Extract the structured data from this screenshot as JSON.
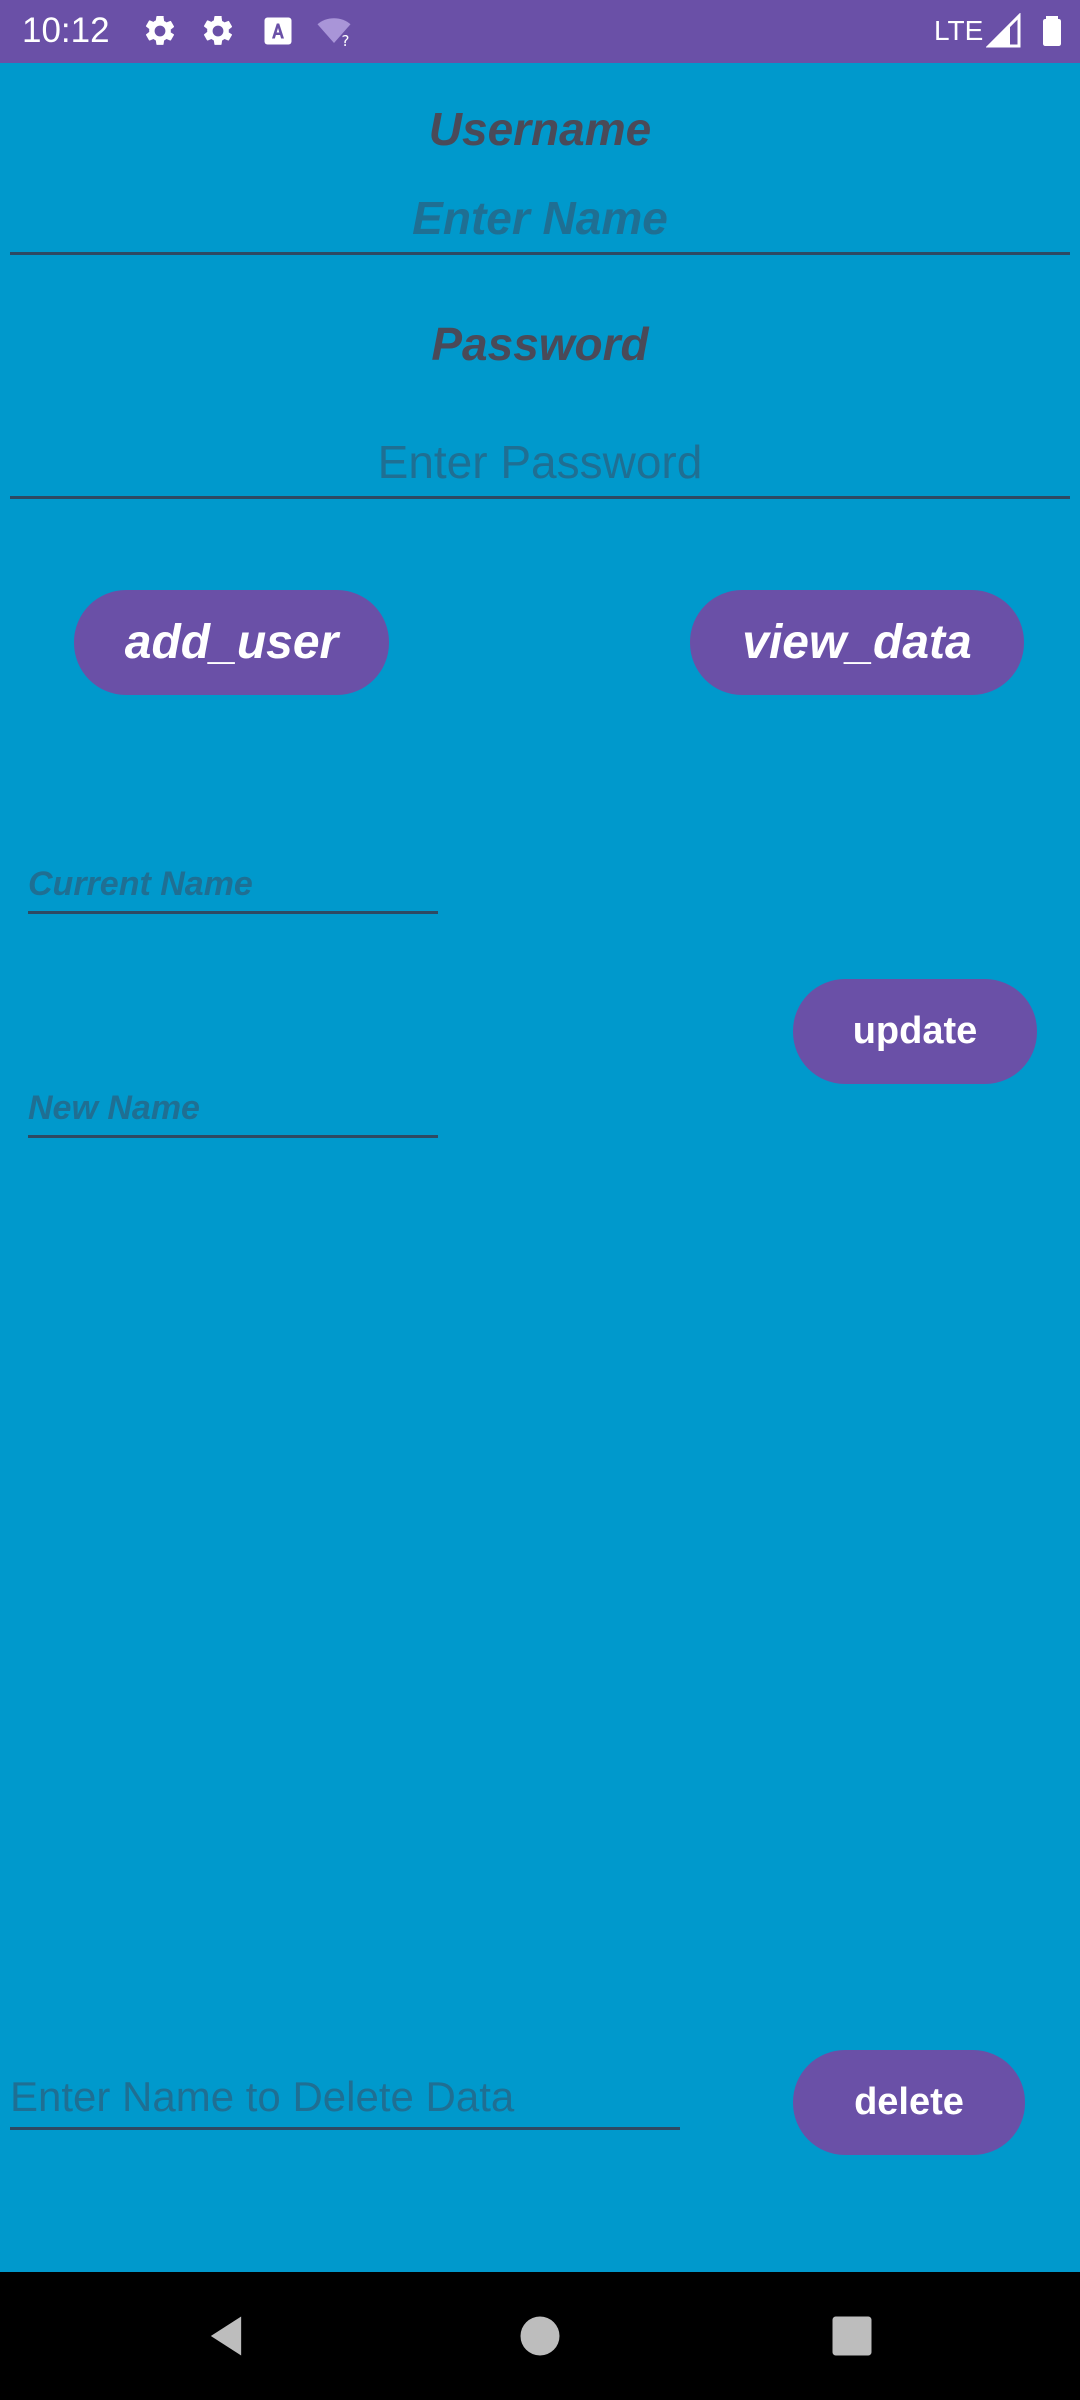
{
  "status_bar": {
    "time": "10:12",
    "network": "LTE",
    "icons": [
      "gear-icon",
      "gear-icon",
      "font-icon",
      "wifi-question-icon",
      "signal-icon",
      "battery-icon"
    ]
  },
  "form": {
    "username_label": "Username",
    "username_placeholder": "Enter Name",
    "password_label": "Password",
    "password_placeholder": "Enter Password",
    "add_user_button": "add_user",
    "view_data_button": "view_data",
    "current_name_placeholder": "Current Name",
    "new_name_placeholder": "New Name",
    "update_button": "update",
    "delete_placeholder": "Enter Name to Delete Data",
    "delete_button": "delete"
  },
  "nav_bar": {
    "icons": [
      "back-icon",
      "home-icon",
      "recents-icon"
    ]
  },
  "colors": {
    "background": "#0099cc",
    "accent": "#6a50a7",
    "label_text": "#4a4a58",
    "hint_text": "#1f6f93"
  }
}
